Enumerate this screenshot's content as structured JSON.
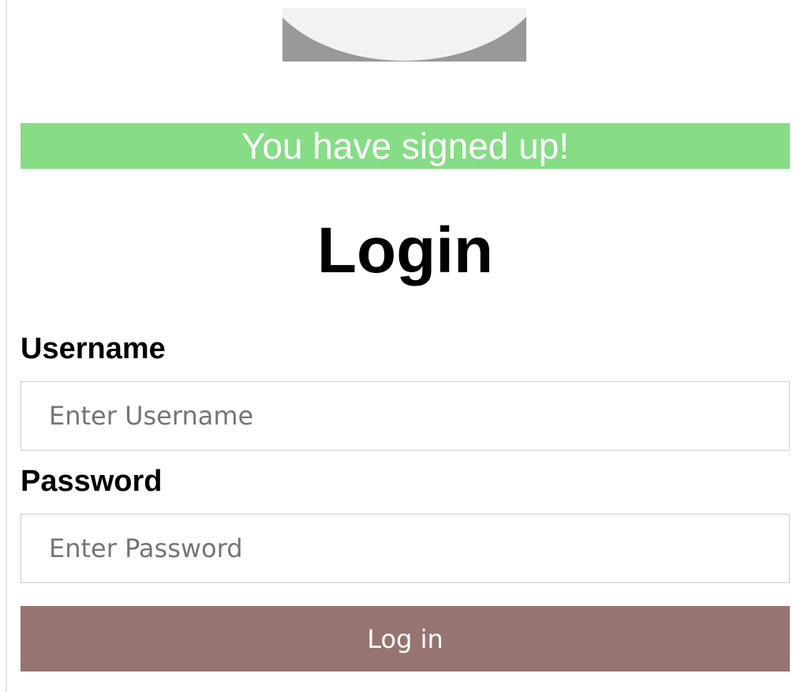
{
  "banner": {
    "message": "You have signed up!"
  },
  "form": {
    "title": "Login",
    "username": {
      "label": "Username",
      "placeholder": "Enter Username"
    },
    "password": {
      "label": "Password",
      "placeholder": "Enter Password"
    },
    "submit_label": "Log in"
  },
  "icons": {
    "avatar": "avatar-icon"
  },
  "colors": {
    "banner_bg": "#86dd86",
    "banner_text": "#ffffff",
    "button_bg": "#96746f",
    "button_text": "#ffffff",
    "avatar_head": "#999999",
    "avatar_body": "#f2f2f2"
  }
}
